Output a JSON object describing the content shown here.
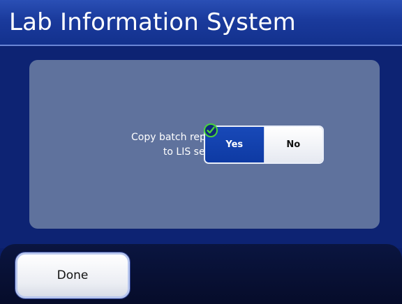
{
  "window": {
    "title": "Lab Information System"
  },
  "setting": {
    "label_line1": "Copy batch reports",
    "label_line2": "to LIS server",
    "selected": "Yes",
    "options": [
      "Yes",
      "No"
    ]
  },
  "footer": {
    "done_label": "Done"
  },
  "icons": {
    "selected_mark": "checkmark-icon"
  },
  "colors": {
    "background": "#0b1f6b",
    "panel": "#5f729d",
    "selected_button": "#0e3aa3",
    "check": "#49d43a"
  }
}
